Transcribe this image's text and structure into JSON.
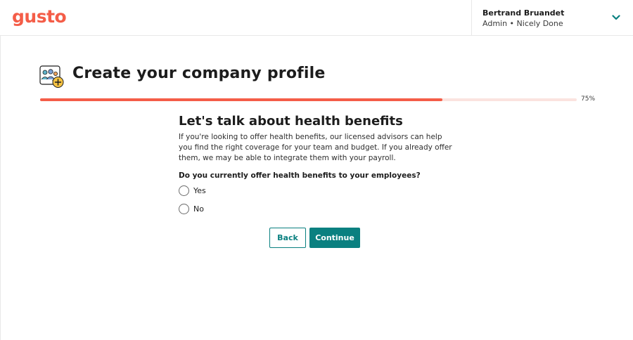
{
  "header": {
    "logo_text": "gusto",
    "user_name": "Bertrand Bruandet",
    "user_role_company": "Admin • Nicely Done",
    "menu_icon": "chevron-down-icon"
  },
  "page": {
    "icon": "company-team-add-icon",
    "title": "Create your company profile"
  },
  "progress": {
    "value": 0.75,
    "label": "75%"
  },
  "section": {
    "title": "Let's talk about health benefits",
    "description": "If you're looking to offer health benefits, our licensed advisors can help you find the right coverage for your team and budget. If you already offer them, we may be able to integrate them with your payroll."
  },
  "question": {
    "label": "Do you currently offer health benefits to your employees?",
    "options": [
      {
        "label": "Yes",
        "selected": false
      },
      {
        "label": "No",
        "selected": false
      }
    ]
  },
  "actions": {
    "back_label": "Back",
    "continue_label": "Continue"
  },
  "colors": {
    "brand": "#f45d48",
    "primary_button": "#0a8080",
    "progress_track": "#fbe3df"
  }
}
